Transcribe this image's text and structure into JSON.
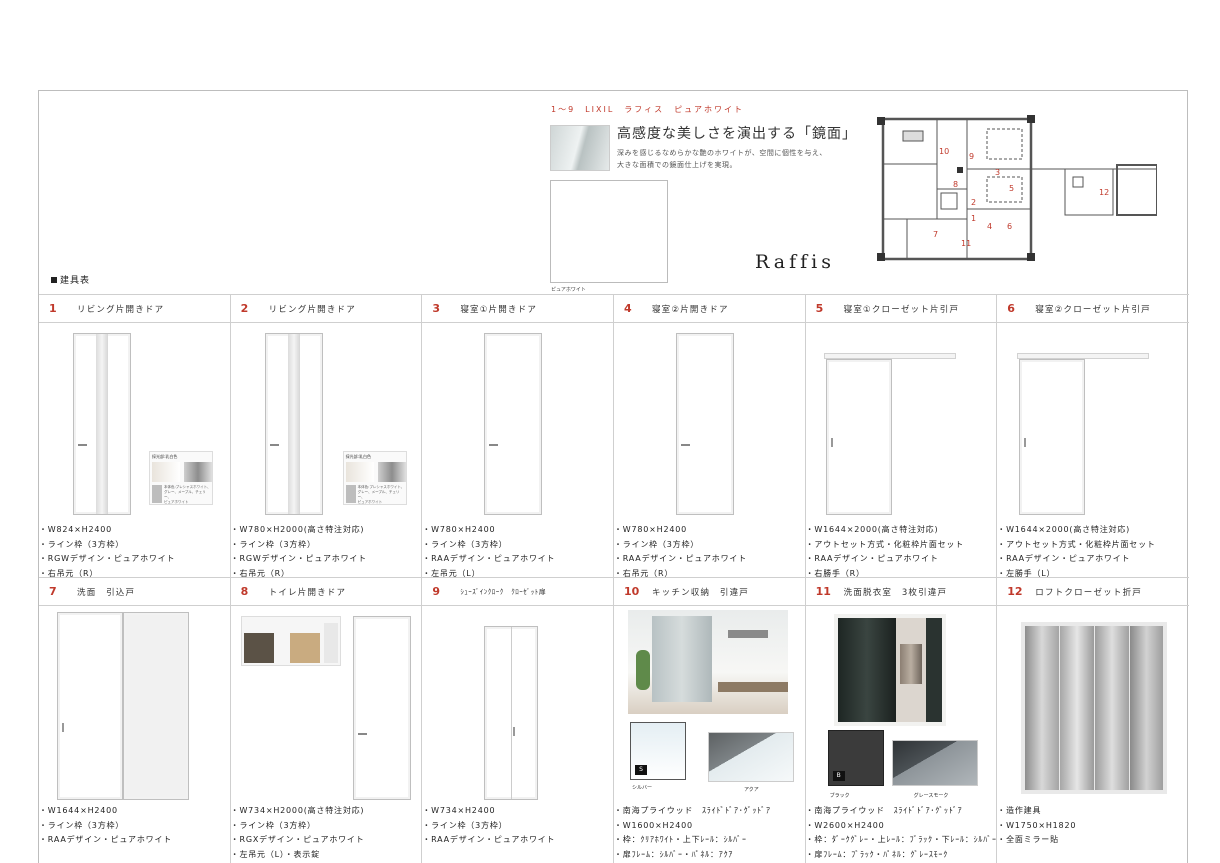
{
  "header": {
    "schedule_label": "建具表",
    "promo_tag": "1～9　LIXIL　ラフィス　ピュアホワイト",
    "promo_headline": "高感度な美しさを演出する「鏡面」",
    "promo_desc_line1": "深みを感じるなめらかな艶のホワイトが、空間に個性を与え、",
    "promo_desc_line2": "大きな面積での鏡面仕上げを実現。",
    "swatch_caption": "ピュアホワイト",
    "brand": "Raffis"
  },
  "plan_labels": [
    "10",
    "9",
    "8",
    "3",
    "5",
    "12",
    "2",
    "7",
    "4",
    "6",
    "1",
    "11"
  ],
  "cells": [
    {
      "num": "1",
      "title": "リビング片開きドア",
      "specs": [
        "・W824×H2400",
        "・ライン枠（3方枠）",
        "・RGWデザイン・ピュアホワイト",
        "・右吊元（R）"
      ],
      "mat_title": "採光部:乳白色",
      "mat_desc": [
        "本体色:プレシャスホワイト、",
        "グレー、メープル、チェリー、",
        "ピュアホワイト"
      ]
    },
    {
      "num": "2",
      "title": "リビング片開きドア",
      "specs": [
        "・W780×H2000(高さ特注対応)",
        "・ライン枠（3方枠）",
        "・RGWデザイン・ピュアホワイト",
        "・右吊元（R）"
      ],
      "mat_title": "採光部:乳白色",
      "mat_desc": [
        "本体色:プレシャスホワイト、",
        "グレー、メープル、チェリー、",
        "ピュアホワイト"
      ]
    },
    {
      "num": "3",
      "title": "寝室①片開きドア",
      "specs": [
        "・W780×H2400",
        "・ライン枠（3方枠）",
        "・RAAデザイン・ピュアホワイト",
        "・左吊元（L）"
      ]
    },
    {
      "num": "4",
      "title": "寝室②片開きドア",
      "specs": [
        "・W780×H2400",
        "・ライン枠（3方枠）",
        "・RAAデザイン・ピュアホワイト",
        "・右吊元（R）"
      ]
    },
    {
      "num": "5",
      "title": "寝室①クローゼット片引戸",
      "specs": [
        "・W1644×2000(高さ特注対応)",
        "・アウトセット方式・化粧枠片面セット",
        "・RAAデザイン・ピュアホワイト",
        "・右勝手（R）"
      ]
    },
    {
      "num": "6",
      "title": "寝室②クローゼット片引戸",
      "specs": [
        "・W1644×2000(高さ特注対応)",
        "・アウトセット方式・化粧枠片面セット",
        "・RAAデザイン・ピュアホワイト",
        "・左勝手（L）"
      ]
    },
    {
      "num": "7",
      "title": "洗面　引込戸",
      "specs": [
        "・W1644×H2400",
        "・ライン枠（3方枠）",
        "・RAAデザイン・ピュアホワイト"
      ]
    },
    {
      "num": "8",
      "title": "トイレ片開きドア",
      "specs": [
        "・W734×H2000(高さ特注対応)",
        "・ライン枠（3方枠）",
        "・RGXデザイン・ピュアホワイト",
        "・左吊元（L）・表示錠"
      ]
    },
    {
      "num": "9",
      "title": "ｼｭｰｽﾞｲﾝｸﾛｰｸ　ｸﾛｰｾﾞｯﾄ扉",
      "specs": [
        "・W734×H2400",
        "・ライン枠（3方枠）",
        "・RAAデザイン・ピュアホワイト"
      ]
    },
    {
      "num": "10",
      "title": "キッチン収納　引違戸",
      "specs": [
        "・南海プライウッド　ｽﾗｲﾄﾞﾄﾞｱ･ｸﾞｯﾄﾞｱ",
        "・W1600×H2400",
        "・枠：ｸﾘｱﾎﾜｲﾄ・上下ﾚｰﾙ：ｼﾙﾊﾞｰ",
        "・扉ﾌﾚｰﾑ：ｼﾙﾊﾞｰ・ﾊﾟﾈﾙ：ｱｸｱ"
      ],
      "sample1": "シルバー",
      "sample1_badge": "S",
      "sample2": "アクア"
    },
    {
      "num": "11",
      "title": "洗面脱衣室　3枚引違戸",
      "specs": [
        "・南海プライウッド　ｽﾗｲﾄﾞﾄﾞｱ･ｸﾞｯﾄﾞｱ",
        "・W2600×H2400",
        "・枠：ﾀﾞｰｸｸﾞﾚｰ・上ﾚｰﾙ：ﾌﾞﾗｯｸ・下ﾚｰﾙ：ｼﾙﾊﾞｰ",
        "・扉ﾌﾚｰﾑ：ﾌﾞﾗｯｸ・ﾊﾟﾈﾙ：ｸﾞﾚｰｽﾓｰｸ"
      ],
      "sample1": "ブラック",
      "sample1_badge": "B",
      "sample2": "グレースモーク"
    },
    {
      "num": "12",
      "title": "ロフトクローゼット折戸",
      "specs": [
        "・造作建具",
        "・W1750×H1820",
        "・全面ミラー貼"
      ]
    }
  ]
}
